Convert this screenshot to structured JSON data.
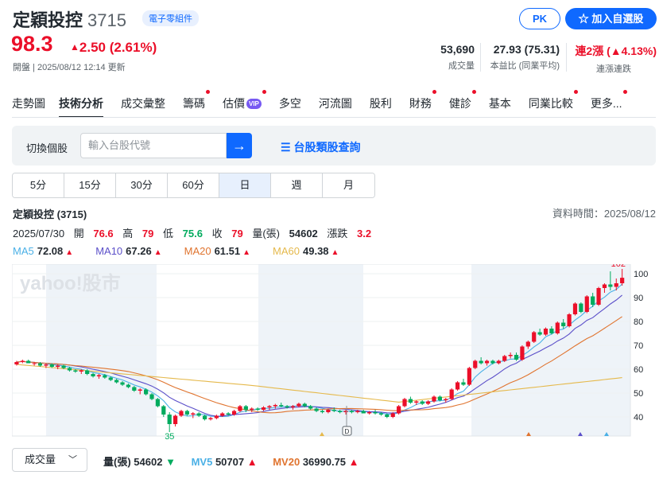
{
  "header": {
    "name": "定穎投控",
    "code": "3715",
    "industry": "電子零組件",
    "price": "98.3",
    "change": "2.50 (2.61%)",
    "market_status": "開盤",
    "updated": "2025/08/12 12:14 更新",
    "pk_label": "PK",
    "add_label": "加入自選股"
  },
  "stats": [
    {
      "value": "53,690",
      "label": "成交量"
    },
    {
      "value": "27.93 (75.31)",
      "label": "本益比 (同業平均)"
    },
    {
      "value": "連2漲 (▲4.13%)",
      "label": "連漲連跌"
    }
  ],
  "nav": [
    {
      "label": "走勢圖",
      "dot": false
    },
    {
      "label": "技術分析",
      "dot": false,
      "active": true
    },
    {
      "label": "成交彙整",
      "dot": false
    },
    {
      "label": "籌碼",
      "dot": true
    },
    {
      "label": "估價",
      "dot": true,
      "vip": "VIP"
    },
    {
      "label": "多空",
      "dot": false
    },
    {
      "label": "河流圖",
      "dot": false
    },
    {
      "label": "股利",
      "dot": false
    },
    {
      "label": "財務",
      "dot": true
    },
    {
      "label": "健診",
      "dot": true
    },
    {
      "label": "基本",
      "dot": false
    },
    {
      "label": "同業比較",
      "dot": true
    },
    {
      "label": "更多...",
      "dot": true
    }
  ],
  "search": {
    "label": "切換個股",
    "placeholder": "輸入台股代號",
    "category_link": "台股類股查詢"
  },
  "periods": [
    "5分",
    "15分",
    "30分",
    "60分",
    "日",
    "週",
    "月"
  ],
  "selected_period": "日",
  "chart_header": {
    "title": "定穎投控 (3715)",
    "data_time": "資料時間：2025/08/12",
    "date": "2025/07/30",
    "open_label": "開",
    "open": "76.6",
    "high_label": "高",
    "high": "79",
    "low_label": "低",
    "low": "75.6",
    "close_label": "收",
    "close": "79",
    "vol_label": "量(張)",
    "vol": "54602",
    "chg_label": "漲跌",
    "chg": "3.2"
  },
  "ma": [
    {
      "name": "MA5",
      "value": "72.08",
      "color": "#4ab0e6"
    },
    {
      "name": "MA10",
      "value": "67.26",
      "color": "#5b4fc9"
    },
    {
      "name": "MA20",
      "value": "61.51",
      "color": "#e0742f"
    },
    {
      "name": "MA60",
      "value": "49.38",
      "color": "#e5b94c"
    }
  ],
  "chart_data": {
    "type": "candlestick",
    "y_ticks": [
      100,
      90,
      80,
      70,
      60,
      50,
      40
    ],
    "ylim": [
      32,
      104
    ],
    "annotations": {
      "max_label": "102",
      "min_label": "35",
      "watermark": "yahoo!股市"
    },
    "candles": [
      [
        62,
        63.5,
        61.5,
        63
      ],
      [
        63,
        64,
        62.5,
        63.5
      ],
      [
        63.5,
        64,
        62.5,
        62.5
      ],
      [
        62.5,
        63,
        61.5,
        62.5
      ],
      [
        62.5,
        63,
        61,
        61.5
      ],
      [
        61.5,
        62.5,
        60.5,
        62
      ],
      [
        62,
        62.5,
        60.5,
        61
      ],
      [
        61,
        62,
        60,
        61.5
      ],
      [
        61.5,
        62,
        60,
        60.5
      ],
      [
        60.5,
        61,
        59,
        59.5
      ],
      [
        59.5,
        60,
        58.5,
        59
      ],
      [
        59,
        60,
        58,
        59.5
      ],
      [
        59.5,
        60,
        57.5,
        58
      ],
      [
        58,
        58.5,
        56.5,
        57
      ],
      [
        57,
        58,
        56,
        57.5
      ],
      [
        57.5,
        58,
        56,
        56.5
      ],
      [
        56.5,
        57,
        55,
        55.5
      ],
      [
        55.5,
        56,
        54,
        54.5
      ],
      [
        54.5,
        55,
        53,
        53.5
      ],
      [
        53.5,
        54,
        52,
        52.5
      ],
      [
        52.5,
        53,
        50.5,
        51
      ],
      [
        51,
        52,
        49.5,
        51.5
      ],
      [
        51.5,
        52,
        49,
        49.5
      ],
      [
        49.5,
        50,
        47,
        47.5
      ],
      [
        47.5,
        48,
        44,
        44.5
      ],
      [
        44.5,
        45,
        40,
        41
      ],
      [
        41,
        42,
        35,
        37
      ],
      [
        37,
        41,
        36,
        40.5
      ],
      [
        40.5,
        43,
        40,
        42.5
      ],
      [
        42.5,
        43,
        40.5,
        41
      ],
      [
        41,
        42,
        39.5,
        41.5
      ],
      [
        41.5,
        42,
        40,
        40.5
      ],
      [
        40.5,
        41,
        38.5,
        39
      ],
      [
        39,
        40,
        38.5,
        39.5
      ],
      [
        39.5,
        41,
        39,
        40.5
      ],
      [
        40.5,
        42,
        40,
        41.5
      ],
      [
        41.5,
        42,
        40.5,
        41
      ],
      [
        41,
        43,
        40.5,
        42.5
      ],
      [
        42.5,
        45,
        42,
        44.5
      ],
      [
        44.5,
        45,
        42,
        43
      ],
      [
        43,
        44,
        42,
        43.5
      ],
      [
        43.5,
        44,
        42.5,
        43
      ],
      [
        43,
        44.5,
        42.5,
        44
      ],
      [
        44,
        45,
        43,
        44.5
      ],
      [
        44.5,
        45.5,
        43.5,
        45
      ],
      [
        45,
        46,
        44,
        44.5
      ],
      [
        44.5,
        45,
        43.5,
        44
      ],
      [
        44,
        45,
        43,
        44.5
      ],
      [
        44.5,
        46,
        44,
        45.5
      ],
      [
        45.5,
        46,
        44,
        44.5
      ],
      [
        44.5,
        45,
        43,
        43.5
      ],
      [
        43.5,
        44,
        42,
        42.5
      ],
      [
        42.5,
        43,
        41.5,
        42
      ],
      [
        42,
        43.5,
        41.5,
        43
      ],
      [
        43,
        44,
        42,
        42.5
      ],
      [
        42.5,
        43,
        41.5,
        42
      ],
      [
        42,
        43,
        41,
        42.5
      ],
      [
        42.5,
        43,
        41.5,
        42
      ],
      [
        42,
        43,
        41.5,
        42.5
      ],
      [
        42.5,
        43,
        41.5,
        41.5
      ],
      [
        41.5,
        42.5,
        41,
        42
      ],
      [
        42,
        43,
        41,
        41.5
      ],
      [
        41.5,
        42,
        40.5,
        41
      ],
      [
        41,
        41.5,
        39.5,
        40
      ],
      [
        40,
        42,
        39.5,
        41.5
      ],
      [
        41.5,
        45,
        41,
        44.5
      ],
      [
        44.5,
        48,
        44,
        47.5
      ],
      [
        47.5,
        48.5,
        45.5,
        46
      ],
      [
        46,
        47,
        45,
        46.5
      ],
      [
        46.5,
        47,
        45,
        45.5
      ],
      [
        45.5,
        47,
        45,
        46.5
      ],
      [
        46.5,
        49,
        46,
        48.5
      ],
      [
        48.5,
        49,
        46.5,
        47
      ],
      [
        47,
        48,
        46,
        47.5
      ],
      [
        47.5,
        52,
        47,
        51.5
      ],
      [
        51.5,
        55,
        51,
        54.5
      ],
      [
        54.5,
        56,
        53,
        53.5
      ],
      [
        53.5,
        61,
        53,
        60.5
      ],
      [
        60.5,
        64,
        60,
        63.5
      ],
      [
        63.5,
        65,
        62,
        62.5
      ],
      [
        62.5,
        64,
        61.5,
        63.5
      ],
      [
        63.5,
        64,
        62,
        62.5
      ],
      [
        62.5,
        64,
        62,
        63.5
      ],
      [
        63.5,
        66,
        63,
        65.5
      ],
      [
        65.5,
        67,
        64.5,
        66
      ],
      [
        66,
        67,
        63.5,
        64
      ],
      [
        64,
        70,
        63.5,
        69.5
      ],
      [
        69.5,
        72,
        68.5,
        71.5
      ],
      [
        71.5,
        76,
        71,
        75.5
      ],
      [
        75.5,
        77,
        74,
        74.5
      ],
      [
        74.5,
        77.5,
        74,
        77
      ],
      [
        77,
        78,
        74.5,
        75
      ],
      [
        75,
        80,
        74.5,
        79.5
      ],
      [
        79.5,
        81,
        77,
        78
      ],
      [
        78,
        83.5,
        77.5,
        83
      ],
      [
        83,
        88,
        82.5,
        87.5
      ],
      [
        87.5,
        88,
        83.5,
        84
      ],
      [
        84,
        91,
        83.5,
        90.5
      ],
      [
        90.5,
        92,
        86,
        87
      ],
      [
        87,
        94.5,
        86.5,
        94
      ],
      [
        94,
        96,
        92,
        95.5
      ],
      [
        95.5,
        101,
        93,
        94.5
      ],
      [
        94.5,
        98,
        93,
        96
      ],
      [
        96,
        102,
        95,
        98.3
      ]
    ]
  },
  "footer": {
    "select_label": "成交量",
    "vol_label": "量(張)",
    "vol_value": "54602",
    "mv5_label": "MV5",
    "mv5_value": "50707",
    "mv20_label": "MV20",
    "mv20_value": "36990.75"
  }
}
